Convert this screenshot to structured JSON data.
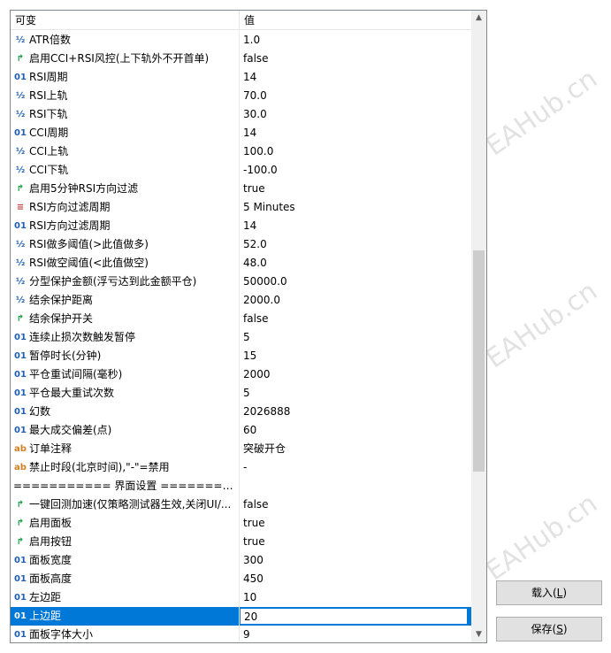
{
  "header": {
    "col_variable": "可变",
    "col_value": "值"
  },
  "rows": [
    {
      "type": "dbl",
      "icon": "½",
      "name": "ATR倍数",
      "value": "1.0"
    },
    {
      "type": "bool",
      "icon": "↱",
      "name": "启用CCI+RSI风控(上下轨外不开首单)",
      "value": "false"
    },
    {
      "type": "num",
      "icon": "01",
      "name": "RSI周期",
      "value": "14"
    },
    {
      "type": "dbl",
      "icon": "½",
      "name": "RSI上轨",
      "value": "70.0"
    },
    {
      "type": "dbl",
      "icon": "½",
      "name": "RSI下轨",
      "value": "30.0"
    },
    {
      "type": "num",
      "icon": "01",
      "name": "CCI周期",
      "value": "14"
    },
    {
      "type": "dbl",
      "icon": "½",
      "name": "CCI上轨",
      "value": "100.0"
    },
    {
      "type": "dbl",
      "icon": "½",
      "name": "CCI下轨",
      "value": "-100.0"
    },
    {
      "type": "bool",
      "icon": "↱",
      "name": "启用5分钟RSI方向过滤",
      "value": "true"
    },
    {
      "type": "enm",
      "icon": "≡",
      "name": "RSI方向过滤周期",
      "value": "5 Minutes"
    },
    {
      "type": "num",
      "icon": "01",
      "name": "RSI方向过滤周期",
      "value": "14"
    },
    {
      "type": "dbl",
      "icon": "½",
      "name": "RSI做多阈值(>此值做多)",
      "value": "52.0"
    },
    {
      "type": "dbl",
      "icon": "½",
      "name": "RSI做空阈值(<此值做空)",
      "value": "48.0"
    },
    {
      "type": "dbl",
      "icon": "½",
      "name": "分型保护金额(浮亏达到此金额平仓)",
      "value": "50000.0"
    },
    {
      "type": "dbl",
      "icon": "½",
      "name": "结余保护距离",
      "value": "2000.0"
    },
    {
      "type": "bool",
      "icon": "↱",
      "name": "结余保护开关",
      "value": "false"
    },
    {
      "type": "num",
      "icon": "01",
      "name": "连续止损次数触发暂停",
      "value": "5"
    },
    {
      "type": "num",
      "icon": "01",
      "name": "暂停时长(分钟)",
      "value": "15"
    },
    {
      "type": "num",
      "icon": "01",
      "name": "平仓重试间隔(毫秒)",
      "value": "2000"
    },
    {
      "type": "num",
      "icon": "01",
      "name": "平仓最大重试次数",
      "value": "5"
    },
    {
      "type": "num",
      "icon": "01",
      "name": "幻数",
      "value": "2026888"
    },
    {
      "type": "num",
      "icon": "01",
      "name": "最大成交偏差(点)",
      "value": "60"
    },
    {
      "type": "str",
      "icon": "ab",
      "name": "订单注释",
      "value": "突破开仓"
    },
    {
      "type": "str",
      "icon": "ab",
      "name": "禁止时段(北京时间),\"-\"=禁用",
      "value": "-"
    },
    {
      "type": "sect",
      "icon": "",
      "name": "=========== 界面设置 ===========",
      "value": ""
    },
    {
      "type": "bool",
      "icon": "↱",
      "name": "一键回测加速(仅策略测试器生效,关闭UI/...",
      "value": "false"
    },
    {
      "type": "bool",
      "icon": "↱",
      "name": "启用面板",
      "value": "true"
    },
    {
      "type": "bool",
      "icon": "↱",
      "name": "启用按钮",
      "value": "true"
    },
    {
      "type": "num",
      "icon": "01",
      "name": "面板宽度",
      "value": "300"
    },
    {
      "type": "num",
      "icon": "01",
      "name": "面板高度",
      "value": "450"
    },
    {
      "type": "num",
      "icon": "01",
      "name": "左边距",
      "value": "10"
    },
    {
      "type": "num",
      "icon": "01",
      "name": "上边距",
      "value": "20",
      "selected": true
    },
    {
      "type": "num",
      "icon": "01",
      "name": "面板字体大小",
      "value": "9"
    }
  ],
  "buttons": {
    "load": "载入(",
    "load_key": "L",
    "save": "保存(",
    "save_key": "S",
    "close_paren": ")"
  },
  "watermark": "EAHub.cn"
}
